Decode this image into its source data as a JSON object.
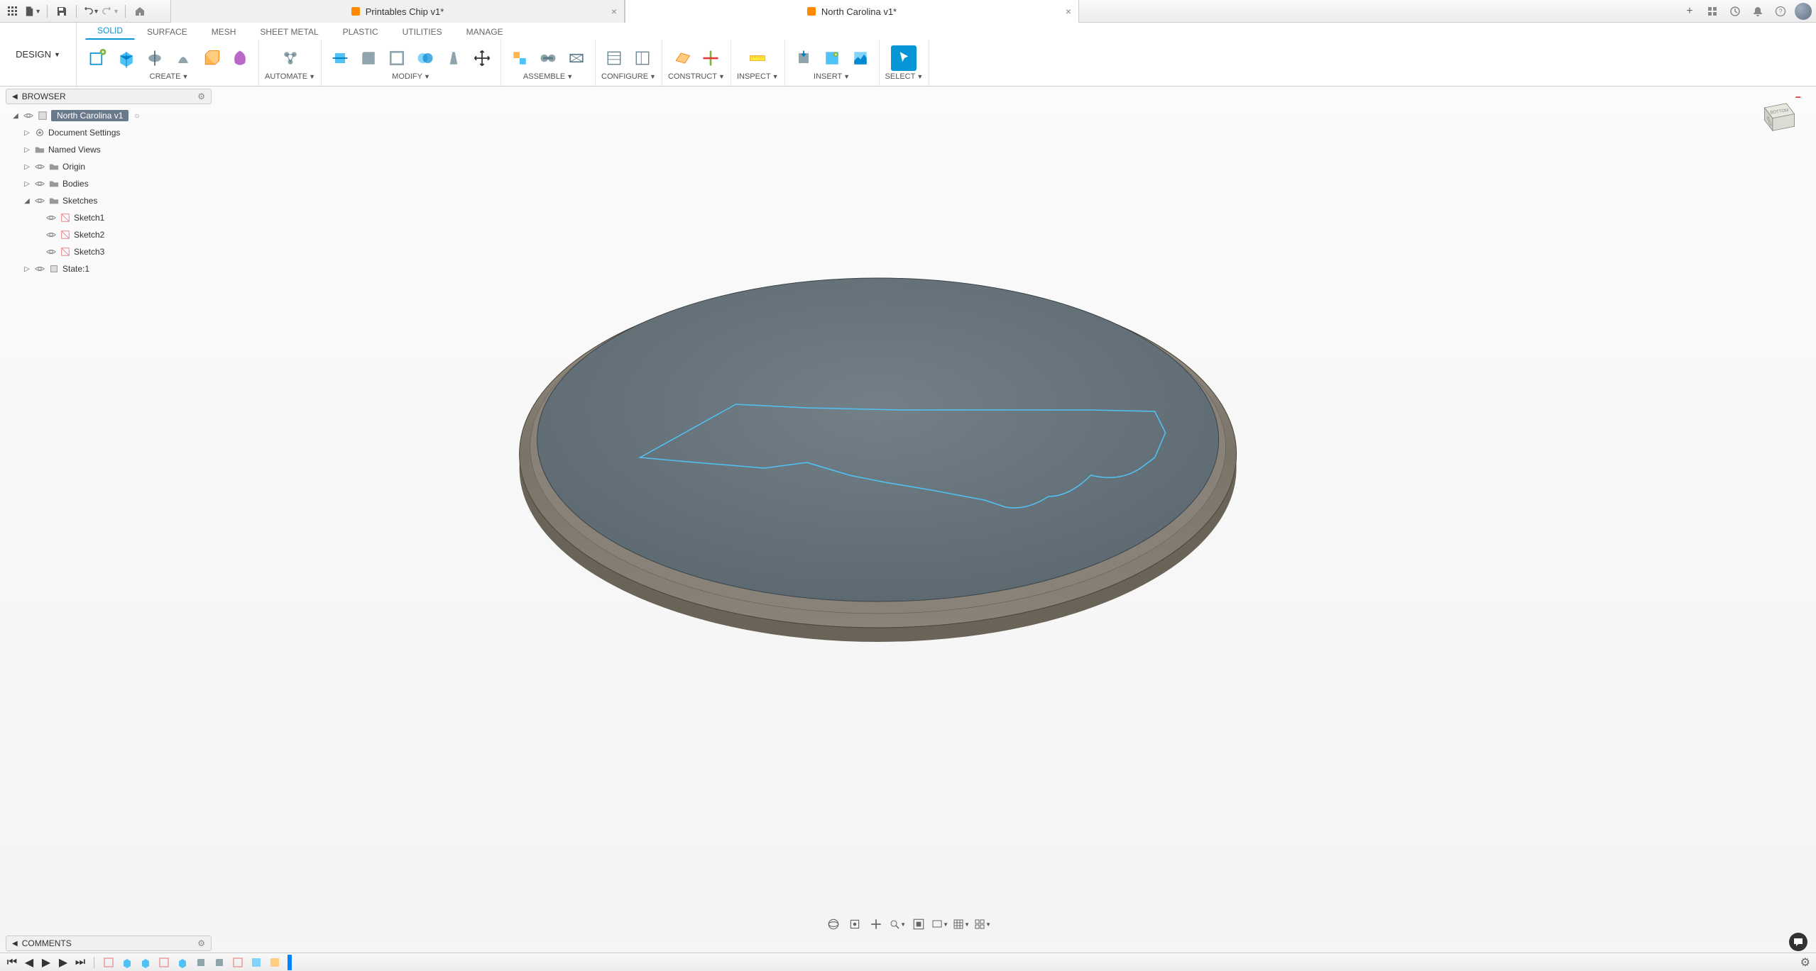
{
  "top_bar": {
    "qat": {
      "apps_icon": "apps",
      "file_icon": "file",
      "save_icon": "save",
      "undo_icon": "undo",
      "redo_icon": "redo",
      "home_icon": "home"
    }
  },
  "doc_tabs": [
    {
      "title": "Printables Chip v1*",
      "active": false
    },
    {
      "title": "North Carolina v1*",
      "active": true
    }
  ],
  "right_icons": {
    "new_tab": "+",
    "extensions": "ext",
    "updates": "upd",
    "notifications": "bell",
    "help": "?",
    "profile": "avatar"
  },
  "workspace": {
    "label": "DESIGN",
    "dropdown": "▼"
  },
  "ribbon_tabs": [
    "SOLID",
    "SURFACE",
    "MESH",
    "SHEET METAL",
    "PLASTIC",
    "UTILITIES",
    "MANAGE"
  ],
  "ribbon_active_tab": "SOLID",
  "ribbon_groups": [
    {
      "label": "CREATE",
      "dropdown": "▼"
    },
    {
      "label": "AUTOMATE",
      "dropdown": "▼"
    },
    {
      "label": "MODIFY",
      "dropdown": "▼"
    },
    {
      "label": "ASSEMBLE",
      "dropdown": "▼"
    },
    {
      "label": "CONFIGURE",
      "dropdown": "▼"
    },
    {
      "label": "CONSTRUCT",
      "dropdown": "▼"
    },
    {
      "label": "INSPECT",
      "dropdown": "▼"
    },
    {
      "label": "INSERT",
      "dropdown": "▼"
    },
    {
      "label": "SELECT",
      "dropdown": "▼"
    }
  ],
  "browser": {
    "title": "BROWSER",
    "root": {
      "label": "North Carolina v1",
      "radio_icon": "○"
    },
    "nodes": [
      {
        "label": "Document Settings",
        "icon": "gear",
        "expandable": true
      },
      {
        "label": "Named Views",
        "icon": "folder",
        "expandable": true
      },
      {
        "label": "Origin",
        "icon": "folder",
        "expandable": true,
        "eye": true
      },
      {
        "label": "Bodies",
        "icon": "folder",
        "expandable": true,
        "eye": true
      },
      {
        "label": "Sketches",
        "icon": "folder",
        "expandable": true,
        "eye": true,
        "expanded": true,
        "children": [
          {
            "label": "Sketch1",
            "icon": "sketch",
            "eye": true
          },
          {
            "label": "Sketch2",
            "icon": "sketch",
            "eye": true
          },
          {
            "label": "Sketch3",
            "icon": "sketch",
            "eye": true
          }
        ]
      },
      {
        "label": "State:1",
        "icon": "state",
        "expandable": true,
        "eye": true
      }
    ]
  },
  "viewcube": {
    "back": "BACK",
    "bottom": "BOTTOM"
  },
  "nav_tools": [
    "orbit",
    "lookat",
    "pan",
    "zoom",
    "fit",
    "display",
    "grid",
    "viewports"
  ],
  "comments": {
    "title": "COMMENTS"
  },
  "timeline": {
    "controls": [
      "first",
      "prev",
      "play",
      "next",
      "last"
    ],
    "features_count": 10
  }
}
